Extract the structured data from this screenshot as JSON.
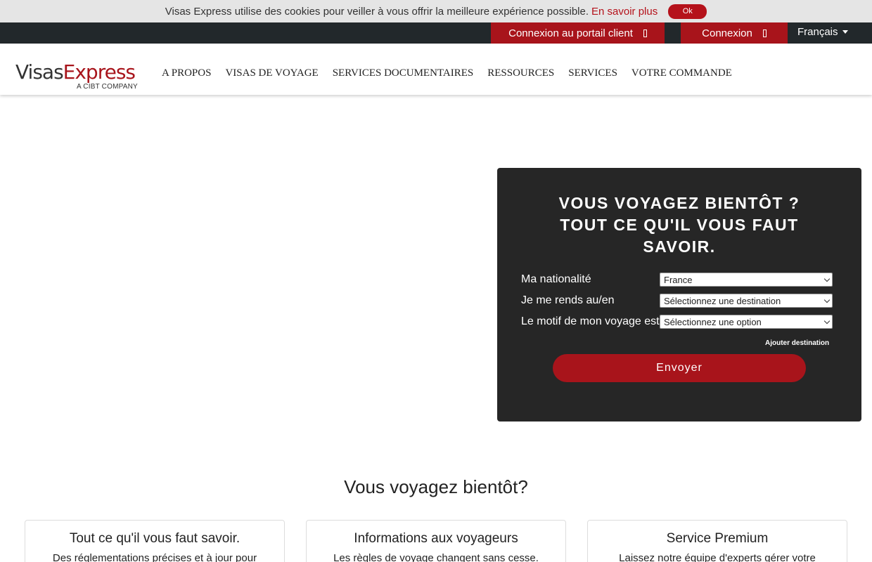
{
  "cookie": {
    "message": "Visas Express utilise des cookies pour veiller à vous offrir la meilleure expérience possible.",
    "learn_more": "En savoir plus",
    "ok": "Ok"
  },
  "topbar": {
    "portal_login": "Connexion au portail client",
    "login": "Connexion",
    "language": "Français"
  },
  "logo": {
    "visas": "Visas",
    "express": "Express",
    "tagline": "A CIBT COMPANY"
  },
  "nav": {
    "items": [
      "A PROPOS",
      "VISAS DE VOYAGE",
      "SERVICES DOCUMENTAIRES",
      "RESSOURCES",
      "SERVICES",
      "VOTRE COMMANDE"
    ]
  },
  "search": {
    "title_line1": "VOUS VOYAGEZ BIENTÔT ?",
    "title_line2": "TOUT CE QU'IL VOUS FAUT",
    "title_line3": "SAVOIR.",
    "nationality_label": "Ma nationalité",
    "nationality_value": "France",
    "destination_label": "Je me rends au/en",
    "destination_value": "Sélectionnez une destination",
    "purpose_label": "Le motif de mon voyage est",
    "purpose_value": "Sélectionnez une option",
    "add_destination": "Ajouter destination",
    "submit": "Envoyer"
  },
  "section": {
    "title": "Vous voyagez bientôt?",
    "cards": [
      {
        "title": "Tout ce qu'il vous faut savoir.",
        "text": "Des réglementations précises et à jour pour"
      },
      {
        "title": "Informations aux voyageurs",
        "text": "Les règles de voyage changent sans cesse."
      },
      {
        "title": "Service Premium",
        "text": "Laissez notre équipe d'experts gérer votre"
      }
    ]
  },
  "colors": {
    "brand_red": "#a8141b",
    "topbar_bg": "#22282b",
    "panel_bg": "#262626",
    "cookie_bg": "#e5e5e5"
  }
}
